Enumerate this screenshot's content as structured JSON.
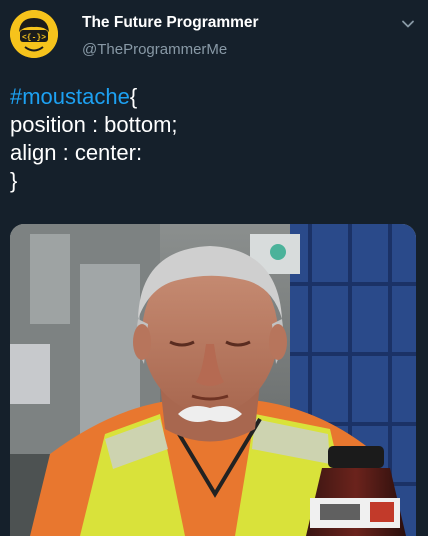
{
  "tweet": {
    "author": {
      "display_name": "The Future Programmer",
      "handle": "@TheProgrammerMe",
      "avatar_icon": "cartoon-programmer-avatar",
      "avatar_text": "<{-}>"
    },
    "menu_icon": "chevron-down-icon",
    "text": {
      "hashtag": "#moustache",
      "brace_open": "{",
      "line2": "position : bottom;",
      "line3": "align : center:",
      "line4": "}"
    },
    "media": {
      "kind": "photo",
      "subject": "man-in-safety-vest-with-moustache"
    }
  },
  "colors": {
    "background": "#15202b",
    "text": "#ffffff",
    "muted": "#8899a6",
    "link": "#1da1f2",
    "avatar_bg": "#f6c31c",
    "vest": "#d9e23a",
    "shirt": "#e8772f"
  }
}
